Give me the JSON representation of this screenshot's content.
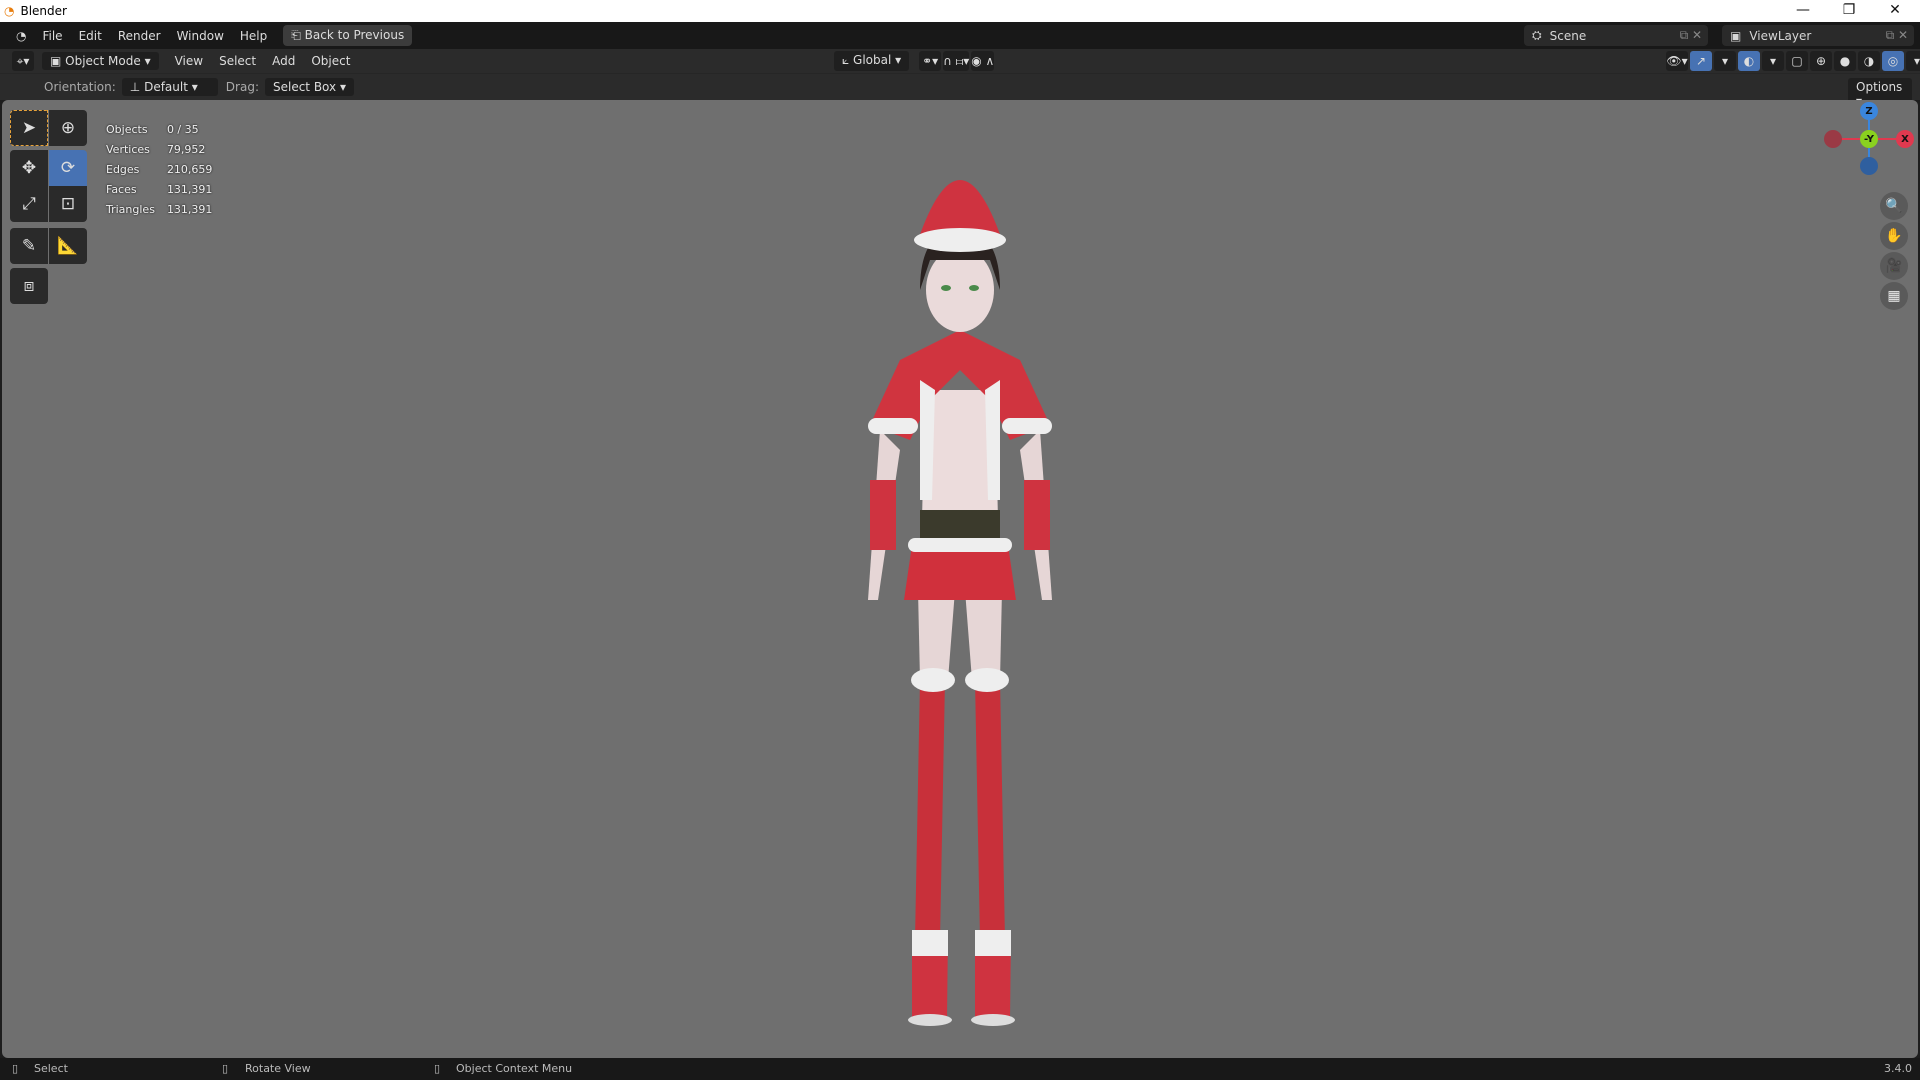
{
  "window": {
    "title": "Blender",
    "minimize": "—",
    "restore": "❐",
    "close": "✕"
  },
  "topbar": {
    "menus": [
      "File",
      "Edit",
      "Render",
      "Window",
      "Help"
    ],
    "back_button": "Back to Previous",
    "scene": "Scene",
    "view_layer": "ViewLayer"
  },
  "header": {
    "mode": "Object Mode",
    "menus": [
      "View",
      "Select",
      "Add",
      "Object"
    ],
    "transform_orientation": "Global"
  },
  "tool_settings": {
    "orientation_label": "Orientation:",
    "orientation_value": "Default",
    "drag_label": "Drag:",
    "drag_value": "Select Box",
    "options": "Options"
  },
  "stats": [
    {
      "label": "Objects",
      "value": "0 / 35"
    },
    {
      "label": "Vertices",
      "value": "79,952"
    },
    {
      "label": "Edges",
      "value": "210,659"
    },
    {
      "label": "Faces",
      "value": "131,391"
    },
    {
      "label": "Triangles",
      "value": "131,391"
    }
  ],
  "gizmo": {
    "z": "Z",
    "y": "-Y",
    "x": "X"
  },
  "status": {
    "left": "Select",
    "middle": "Rotate View",
    "right": "Object Context Menu",
    "version": "3.4.0"
  },
  "colors": {
    "accent": "#4772b3",
    "viewport": "#6f6f6f",
    "x_axis": "#e0394f",
    "y_axis": "#8ad11f",
    "z_axis": "#3a86de"
  }
}
